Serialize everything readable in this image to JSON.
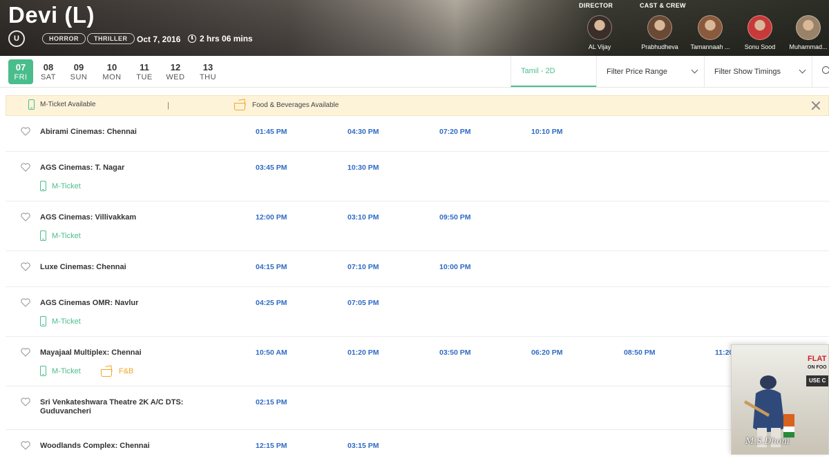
{
  "movie": {
    "title": "Devi (L)",
    "certificate": "U",
    "genres": [
      "HORROR",
      "THRILLER"
    ],
    "release_date": "Oct 7, 2016",
    "duration": "2 hrs 06 mins"
  },
  "credits": {
    "director_label": "DIRECTOR",
    "cast_label": "CAST & CREW",
    "people": [
      {
        "name": "AL Vijay",
        "avatar_color": "#3b2e2a"
      },
      {
        "name": "Prabhudheva",
        "avatar_color": "#6b4a35"
      },
      {
        "name": "Tamannaah ...",
        "avatar_color": "#8a5a3c"
      },
      {
        "name": "Sonu Sood",
        "avatar_color": "#c73a3a"
      },
      {
        "name": "Muhammad...",
        "avatar_color": "#9a8268"
      }
    ]
  },
  "dates": [
    {
      "num": "07",
      "day": "FRI",
      "active": true
    },
    {
      "num": "08",
      "day": "SAT"
    },
    {
      "num": "09",
      "day": "SUN"
    },
    {
      "num": "10",
      "day": "MON"
    },
    {
      "num": "11",
      "day": "TUE"
    },
    {
      "num": "12",
      "day": "WED"
    },
    {
      "num": "13",
      "day": "THU"
    }
  ],
  "filters": {
    "language": "Tamil - 2D",
    "price": "Filter Price Range",
    "timings": "Filter Show Timings"
  },
  "banner": {
    "mticket": "M-Ticket Available",
    "separator": "|",
    "fnb": "Food & Beverages Available"
  },
  "amenity_labels": {
    "mticket": "M-Ticket",
    "fnb": "F&B"
  },
  "cinemas": [
    {
      "name": "Abirami Cinemas: Chennai",
      "times": [
        "01:45 PM",
        "04:30 PM",
        "07:20 PM",
        "10:10 PM"
      ],
      "mticket": false,
      "fnb": false
    },
    {
      "name": "AGS Cinemas: T. Nagar",
      "times": [
        "03:45 PM",
        "10:30 PM"
      ],
      "mticket": true,
      "fnb": false
    },
    {
      "name": "AGS Cinemas: Villivakkam",
      "times": [
        "12:00 PM",
        "03:10 PM",
        "09:50 PM"
      ],
      "mticket": true,
      "fnb": false
    },
    {
      "name": "Luxe Cinemas: Chennai",
      "times": [
        "04:15 PM",
        "07:10 PM",
        "10:00 PM"
      ],
      "mticket": false,
      "fnb": false
    },
    {
      "name": "AGS Cinemas OMR: Navlur",
      "times": [
        "04:25 PM",
        "07:05 PM"
      ],
      "mticket": true,
      "fnb": false
    },
    {
      "name": "Mayajaal Multiplex: Chennai",
      "times": [
        "10:50 AM",
        "01:20 PM",
        "03:50 PM",
        "06:20 PM",
        "08:50 PM",
        "11:20"
      ],
      "mticket": true,
      "fnb": true
    },
    {
      "name": "Sri Venkateshwara Theatre 2K A/C DTS: Guduvancheri",
      "times": [
        "02:15 PM"
      ],
      "mticket": false,
      "fnb": false
    },
    {
      "name": "Woodlands Complex: Chennai",
      "times": [
        "12:15 PM",
        "03:15 PM"
      ],
      "mticket": false,
      "fnb": false
    }
  ],
  "ad": {
    "flat": "FLAT",
    "food": "ON FOO",
    "use": "USE C",
    "logo": "M.S.Dhoni"
  },
  "colors": {
    "accent": "#4abd8c",
    "showtime": "#2d6ac4",
    "fnb": "#f5a623"
  }
}
